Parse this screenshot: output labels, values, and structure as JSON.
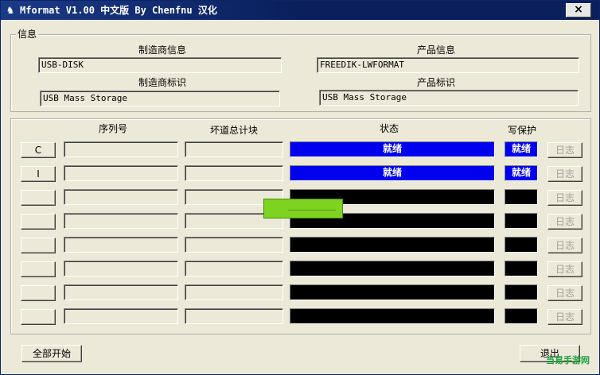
{
  "window": {
    "title": "Mformat V1.00 中文版 By Chenfnu 汉化",
    "close_label": "×"
  },
  "info": {
    "group_label": "信息",
    "manufacturer_info_label": "制造商信息",
    "manufacturer_info_value": "USB-DISK",
    "product_info_label": "产品信息",
    "product_info_value": "FREEDIK-LWFORMAT",
    "manufacturer_id_label": "制造商标识",
    "manufacturer_id_value": "USB Mass Storage",
    "product_id_label": "产品标识",
    "product_id_value": "USB Mass Storage"
  },
  "table": {
    "headers": {
      "serial": "序列号",
      "bad_blocks": "坏道总计块",
      "status": "状态",
      "write_protect": "写保护"
    },
    "rows": [
      {
        "drive": "C",
        "serial": "",
        "bad_blocks": "",
        "status": "就绪",
        "write_protect": "就绪",
        "log": "日志"
      },
      {
        "drive": "I",
        "serial": "",
        "bad_blocks": "",
        "status": "就绪",
        "write_protect": "就绪",
        "log": "日志"
      },
      {
        "drive": "",
        "serial": "",
        "bad_blocks": "",
        "status": "",
        "write_protect": "",
        "log": "日志"
      },
      {
        "drive": "",
        "serial": "",
        "bad_blocks": "",
        "status": "",
        "write_protect": "",
        "log": "日志"
      },
      {
        "drive": "",
        "serial": "",
        "bad_blocks": "",
        "status": "",
        "write_protect": "",
        "log": "日志"
      },
      {
        "drive": "",
        "serial": "",
        "bad_blocks": "",
        "status": "",
        "write_protect": "",
        "log": "日志"
      },
      {
        "drive": "",
        "serial": "",
        "bad_blocks": "",
        "status": "",
        "write_protect": "",
        "log": "日志"
      },
      {
        "drive": "",
        "serial": "",
        "bad_blocks": "",
        "status": "",
        "write_protect": "",
        "log": "日志"
      }
    ]
  },
  "footer": {
    "start_all_label": "全部开始",
    "exit_label": "退出",
    "watermark": "当易手游网"
  },
  "colors": {
    "ready": "#0000ee",
    "idle": "#000000",
    "overlay": "#7ed321",
    "face": "#ece9d8"
  }
}
